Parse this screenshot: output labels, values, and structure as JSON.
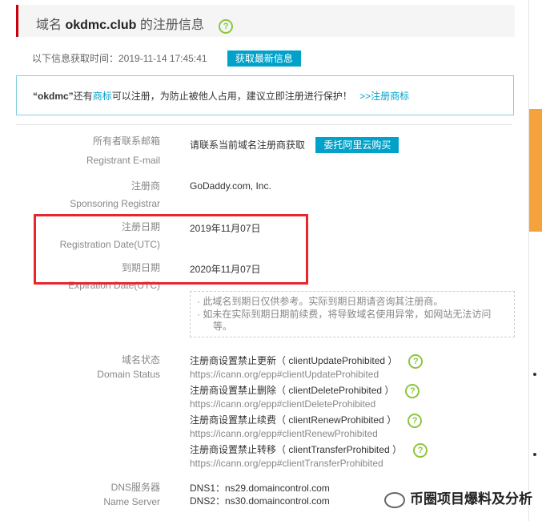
{
  "header": {
    "prefix": "域名",
    "domain": "okdmc.club",
    "suffix": "的注册信息"
  },
  "fetch": {
    "time_text": "以下信息获取时间：2019-11-14 17:45:41",
    "refresh_label": "获取最新信息"
  },
  "notice": {
    "name": "“okdmc”",
    "text1": "还有",
    "link1": "商标",
    "text2": "可以注册，为防止被他人占用，建议立即注册进行保护！",
    "link2": ">>注册商标"
  },
  "rows": {
    "email": {
      "label_cn": "所有者联系邮箱",
      "label_en": "Registrant E-mail",
      "value": "请联系当前域名注册商获取",
      "button": "委托阿里云购买"
    },
    "registrar": {
      "label_cn": "注册商",
      "label_en": "Sponsoring Registrar",
      "value": "GoDaddy.com, Inc."
    },
    "reg_date": {
      "label_cn": "注册日期",
      "label_en": "Registration Date(UTC)",
      "value": "2019年11月07日"
    },
    "exp_date": {
      "label_cn": "到期日期",
      "label_en": "Expiration Date(UTC)",
      "value": "2020年11月07日"
    }
  },
  "expiry_note": {
    "line1": "· 此域名到期日仅供参考。实际到期日期请咨询其注册商。",
    "line2": "· 如未在实际到期日期前续费，将导致域名使用异常，如网站无法访问",
    "line3": "等。"
  },
  "status": {
    "label_cn": "域名状态",
    "label_en": "Domain Status",
    "items": [
      {
        "name": "注册商设置禁止更新（ clientUpdateProhibited ）",
        "url": "https://icann.org/epp#clientUpdateProhibited"
      },
      {
        "name": "注册商设置禁止删除（ clientDeleteProhibited ）",
        "url": "https://icann.org/epp#clientDeleteProhibited"
      },
      {
        "name": "注册商设置禁止续费（ clientRenewProhibited ）",
        "url": "https://icann.org/epp#clientRenewProhibited"
      },
      {
        "name": "注册商设置禁止转移（ clientTransferProhibited ）",
        "url": "https://icann.org/epp#clientTransferProhibited"
      }
    ]
  },
  "dns": {
    "label_cn": "DNS服务器",
    "label_en": "Name Server",
    "dns1": "DNS1：ns29.domaincontrol.com",
    "dns2": "DNS2：ns30.domaincontrol.com"
  },
  "watermark": {
    "text": "币圈项目爆料及分析"
  },
  "colors": {
    "accent": "#00a2ca",
    "highlight": "#e8262d",
    "help": "#8cc63f",
    "sidebar": "#f5a23c"
  },
  "icons": {
    "help": "question-circle-icon",
    "wechat": "wechat-icon"
  }
}
